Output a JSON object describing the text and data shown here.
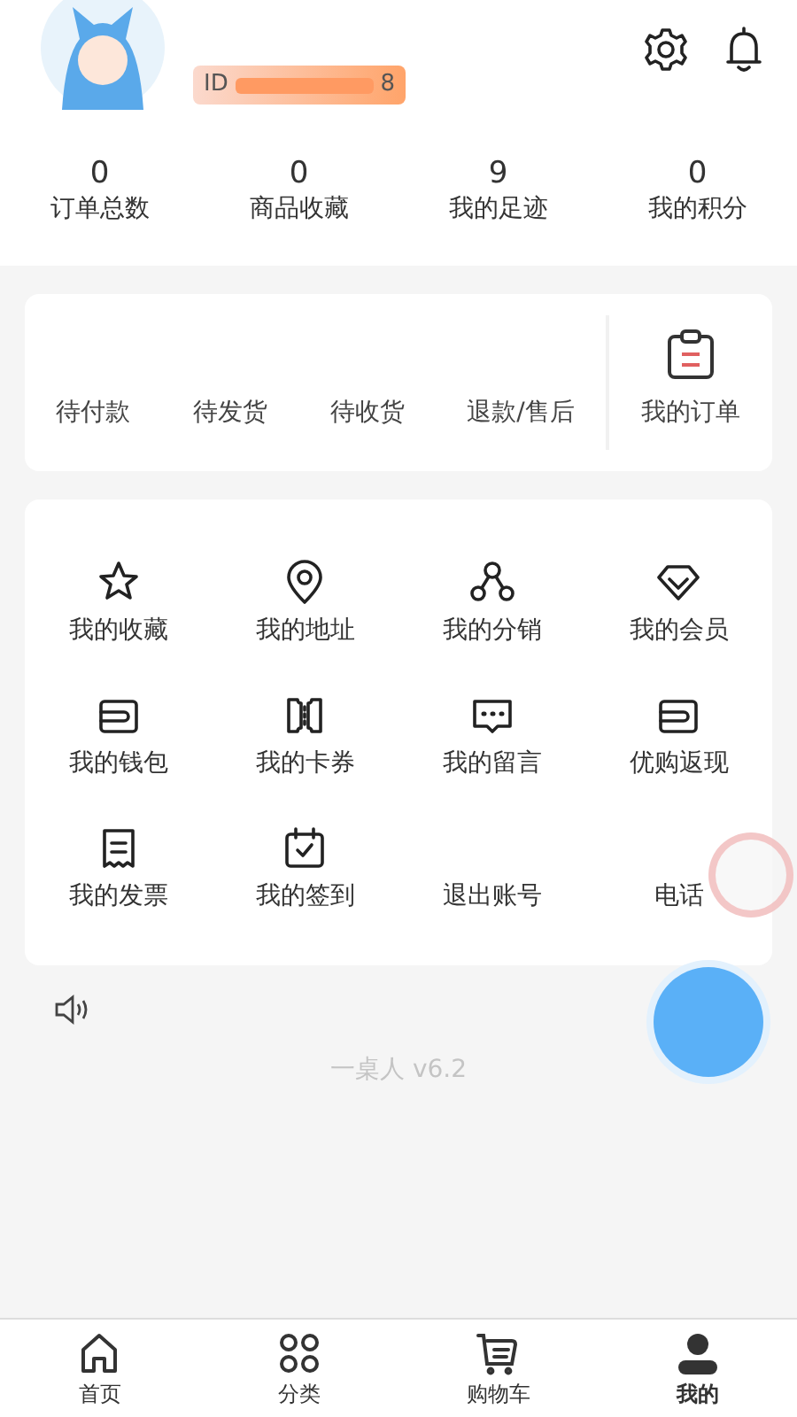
{
  "profile": {
    "id_label": "ID",
    "id_suffix": "8"
  },
  "stats": [
    {
      "value": "0",
      "label": "订单总数"
    },
    {
      "value": "0",
      "label": "商品收藏"
    },
    {
      "value": "9",
      "label": "我的足迹"
    },
    {
      "value": "0",
      "label": "我的积分"
    }
  ],
  "order_status": [
    "待付款",
    "待发货",
    "待收货",
    "退款/售后"
  ],
  "my_orders": "我的订单",
  "services": [
    {
      "label": "我的收藏"
    },
    {
      "label": "我的地址"
    },
    {
      "label": "我的分销"
    },
    {
      "label": "我的会员"
    },
    {
      "label": "我的钱包"
    },
    {
      "label": "我的卡券"
    },
    {
      "label": "我的留言"
    },
    {
      "label": "优购返现"
    },
    {
      "label": "我的发票"
    },
    {
      "label": "我的签到"
    },
    {
      "label": "退出账号"
    },
    {
      "label": "电话"
    }
  ],
  "version": "一桌人 v6.2",
  "tab_bar": [
    {
      "label": "首页",
      "selected": false
    },
    {
      "label": "分类",
      "selected": false
    },
    {
      "label": "购物车",
      "selected": false
    },
    {
      "label": "我的",
      "selected": true
    }
  ]
}
